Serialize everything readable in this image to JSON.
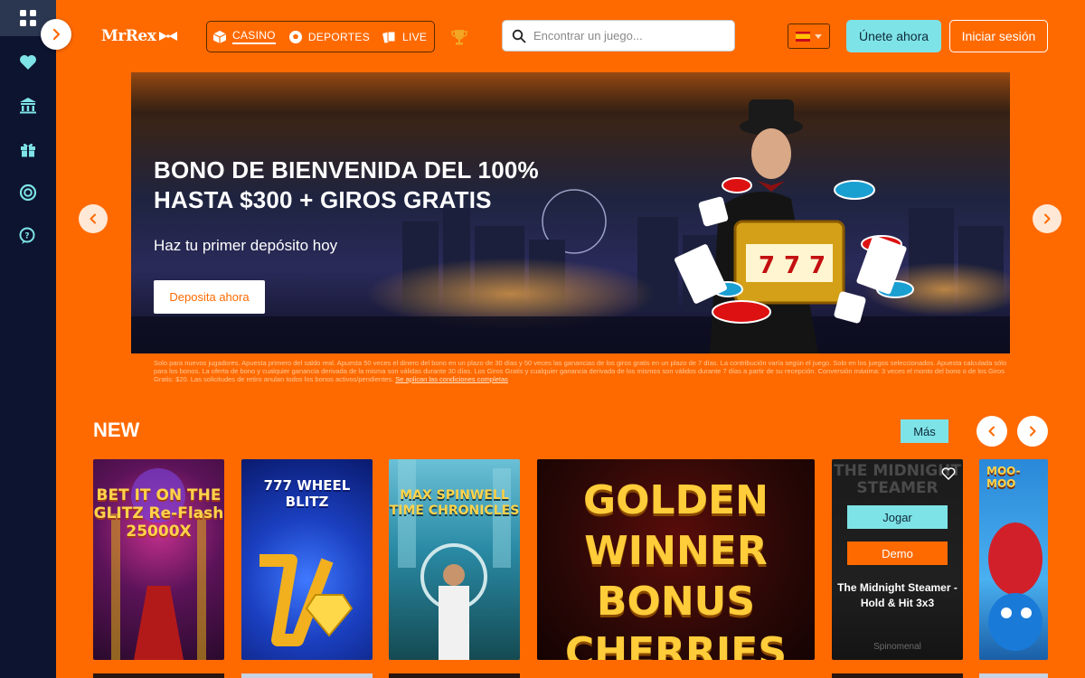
{
  "header": {
    "logo": "MrRex",
    "nav": [
      {
        "label": "CASINO",
        "icon": "cube-icon"
      },
      {
        "label": "DEPORTES",
        "icon": "soccer-ball-icon"
      },
      {
        "label": "LIVE",
        "icon": "cards-icon"
      }
    ],
    "search_placeholder": "Encontrar un juego...",
    "language": "es",
    "join_label": "Únete ahora",
    "login_label": "Iniciar sesión"
  },
  "sidebar": {
    "items": [
      {
        "icon": "grid-icon",
        "active": true
      },
      {
        "icon": "heart-icon"
      },
      {
        "icon": "casino-building-icon"
      },
      {
        "icon": "gift-icon"
      },
      {
        "icon": "lifebuoy-icon"
      },
      {
        "icon": "chat-help-icon"
      }
    ]
  },
  "banner": {
    "title": "BONO DE BIENVENIDA DEL 100% HASTA $300 + GIROS GRATIS",
    "subtitle": "Haz tu primer depósito hoy",
    "cta": "Deposita ahora",
    "disclaimer": "Solo para nuevos jugadores. Apuesta primero del saldo real. Apuesta 50 veces el dinero del bono en un plazo de 30 días y 50 veces las ganancias de los giros gratis en un plazo de 7 días. La contribución varía según el juego. Solo en los juegos seleccionados. Apuesta calculada sólo para los bonos. La oferta de bono y cualquier ganancia derivada de la misma son válidas durante 30 días. Los Giros Gratis y cualquier ganancia derivada de los mismos son válidos durante 7 días a partir de su recepción. Conversión máxima: 3 veces el monto del bono o de los Giros Gratis: $20. Las solicitudes de retiro anulan todos los bonos activos/pendientes.",
    "terms_link": "Se aplican las condiciones completas"
  },
  "new_section": {
    "title": "NEW",
    "more_label": "Más",
    "games": [
      {
        "title": "BET IT ON THE GLITZ Re-Flash 25000X"
      },
      {
        "title": "777 WHEEL BLITZ"
      },
      {
        "title": "MAX SPINWELL TIME CHRONICLES"
      },
      {
        "title": "GOLDEN WINNER BONUS CHERRIES"
      },
      {
        "title": "The Midnight Steamer - Hold & Hit 3x3",
        "hover": true,
        "play_label": "Jogar",
        "demo_label": "Demo",
        "provider": "Spinomenal",
        "art_text": "THE MIDNIGHT STEAMER"
      },
      {
        "title": "MOO-MOO"
      }
    ]
  },
  "colors": {
    "background": "#ff6a00",
    "sidebar": "#0c1430",
    "accent": "#7ee3e6"
  }
}
